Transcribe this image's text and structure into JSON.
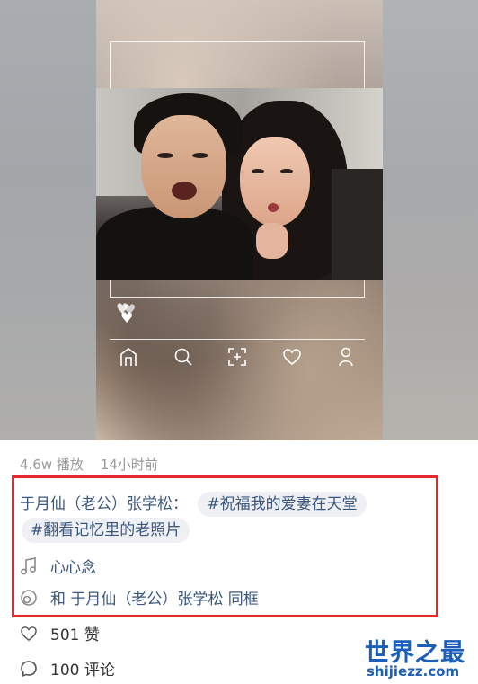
{
  "video": {
    "nav_icons": [
      "home-icon",
      "search-icon",
      "scan-icon",
      "heart-icon",
      "profile-icon"
    ]
  },
  "stats": {
    "plays": "4.6w 播放",
    "time": "14小时前"
  },
  "post": {
    "author": "于月仙（老公）张学松：",
    "tags": [
      "#祝福我的爱妻在天堂",
      "#翻看记忆里的老照片"
    ]
  },
  "music": {
    "icon": "music-note-icon",
    "label": "心心念"
  },
  "duet": {
    "icon": "duet-icon",
    "label": "和 于月仙（老公）张学松 同框"
  },
  "likes": {
    "icon": "heart-outline-icon",
    "label": "501 赞"
  },
  "comments": {
    "icon": "comment-icon",
    "label": "100 评论"
  },
  "watermark": {
    "main": "世界之最",
    "sub": "shijiezz.com"
  },
  "colors": {
    "highlight_border": "#e8272d",
    "link": "#3b5780",
    "watermark": "#1d5fb8"
  }
}
